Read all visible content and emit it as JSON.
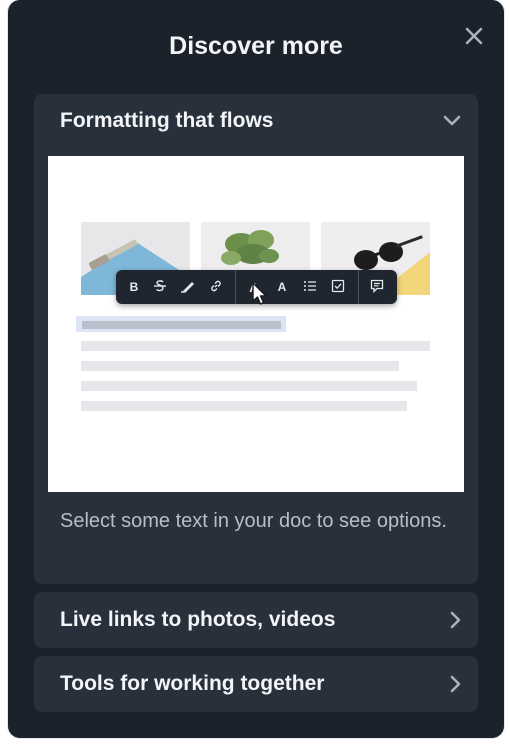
{
  "panel": {
    "title": "Discover more"
  },
  "close": {
    "icon": "close-icon"
  },
  "cards": [
    {
      "title": "Formatting that flows",
      "expanded": true,
      "description": "Select some text in your doc to see options."
    },
    {
      "title": "Live links to photos, videos",
      "expanded": false
    },
    {
      "title": "Tools for working together",
      "expanded": false
    }
  ],
  "preview": {
    "toolbar": {
      "bold_label": "B",
      "text_style_label_1": "A",
      "text_style_label_2": "A"
    }
  },
  "colors": {
    "panel_bg": "#1b222b",
    "card_bg": "#28303b",
    "text_primary": "#f2f4f7",
    "text_secondary": "#b8bec7"
  }
}
